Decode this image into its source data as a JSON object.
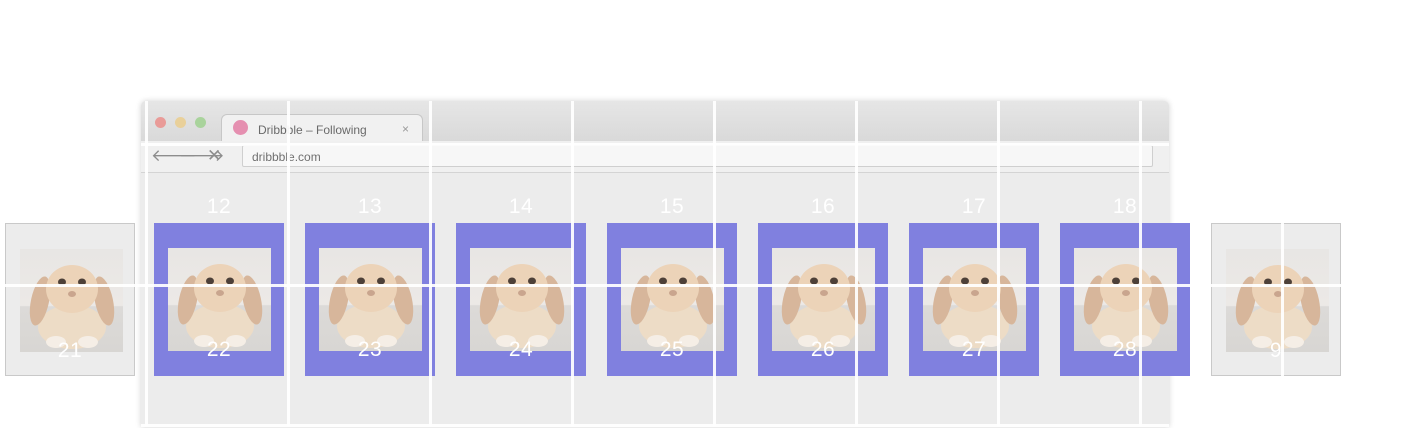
{
  "browser": {
    "tab_title": "Dribbble – Following",
    "tab_close": "×",
    "back_glyph": "🡐",
    "forward_glyph": "🡒",
    "stop_glyph": "✕",
    "url": "dribbble.com"
  },
  "tiles": [
    {
      "top": "",
      "bottom": "21",
      "state": "inactive"
    },
    {
      "top": "12",
      "bottom": "22",
      "state": "active"
    },
    {
      "top": "13",
      "bottom": "23",
      "state": "active"
    },
    {
      "top": "14",
      "bottom": "24",
      "state": "active"
    },
    {
      "top": "15",
      "bottom": "25",
      "state": "active"
    },
    {
      "top": "16",
      "bottom": "26",
      "state": "active"
    },
    {
      "top": "17",
      "bottom": "27",
      "state": "active"
    },
    {
      "top": "18",
      "bottom": "28",
      "state": "active"
    },
    {
      "top": "",
      "bottom": "9",
      "state": "inactive"
    }
  ],
  "colors": {
    "active_tile": "#8080df",
    "inactive_tile": "#ececec",
    "grid_line": "#ffffff"
  },
  "icons": {
    "close_dot": "red-traffic-light-icon",
    "minimize_dot": "yellow-traffic-light-icon",
    "zoom_dot": "green-traffic-light-icon",
    "favicon": "dribbble-favicon-icon"
  }
}
